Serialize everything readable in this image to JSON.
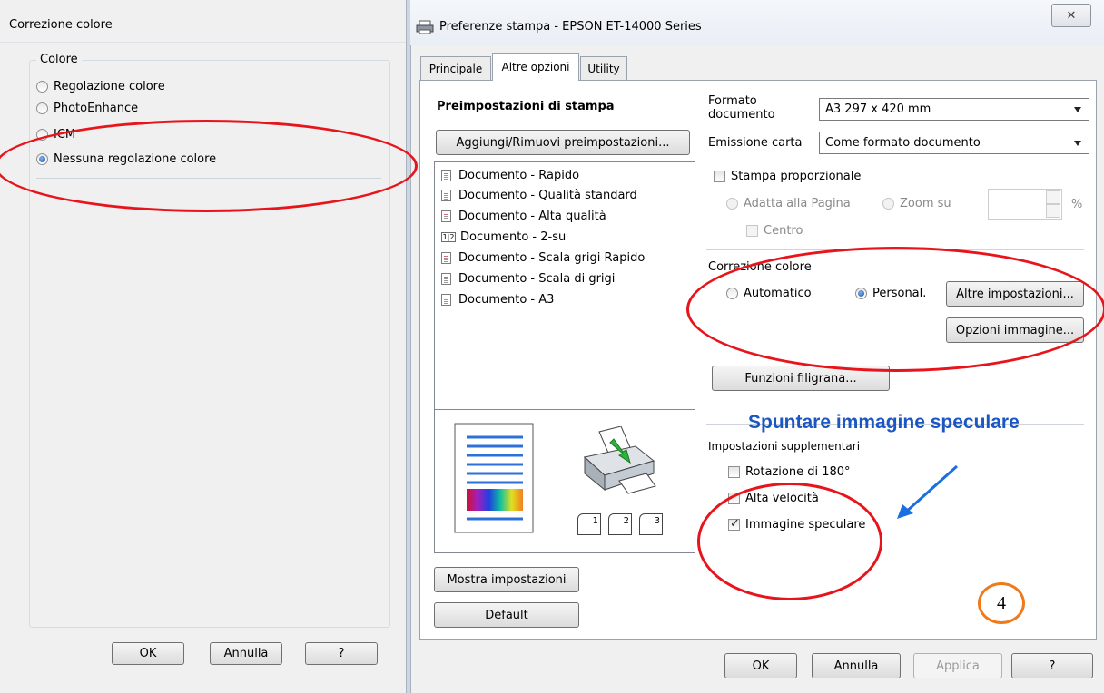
{
  "left_dialog": {
    "title": "Correzione colore",
    "group_label": "Colore",
    "options": [
      {
        "label": "Regolazione colore",
        "selected": false
      },
      {
        "label": "PhotoEnhance",
        "selected": false
      },
      {
        "label": "ICM",
        "selected": false
      },
      {
        "label": "Nessuna regolazione colore",
        "selected": true
      }
    ],
    "buttons": {
      "ok": "OK",
      "cancel": "Annulla",
      "help": "?"
    }
  },
  "right_dialog": {
    "title": "Preferenze stampa - EPSON ET-14000 Series",
    "close": "✕",
    "tabs": [
      {
        "label": "Principale",
        "active": false
      },
      {
        "label": "Altre opzioni",
        "active": true
      },
      {
        "label": "Utility",
        "active": false
      }
    ],
    "presets": {
      "heading": "Preimpostazioni di stampa",
      "manage_button": "Aggiungi/Rimuovi preimpostazioni...",
      "items": [
        {
          "label": "Documento - Rapido",
          "icon": "document-icon"
        },
        {
          "label": "Documento - Qualità standard",
          "icon": "document-icon"
        },
        {
          "label": "Documento - Alta qualità",
          "icon": "document-icon"
        },
        {
          "label": "Documento - 2-su",
          "icon": "two-up-icon",
          "icon_text": "1|2"
        },
        {
          "label": "Documento - Scala grigi Rapido",
          "icon": "document-icon"
        },
        {
          "label": "Documento - Scala di grigi",
          "icon": "document-icon"
        },
        {
          "label": "Documento - A3",
          "icon": "document-icon"
        }
      ],
      "show_settings_button": "Mostra impostazioni",
      "default_button": "Default"
    },
    "preview": {
      "collate_labels": [
        "1",
        "2",
        "3"
      ]
    },
    "paper": {
      "format_label": "Formato documento",
      "format_value": "A3 297 x 420 mm",
      "output_label": "Emissione carta",
      "output_value": "Come formato documento"
    },
    "scaling": {
      "proportional_label": "Stampa proporzionale",
      "fit_page_label": "Adatta alla Pagina",
      "zoom_label": "Zoom su",
      "percent": "%",
      "center_label": "Centro"
    },
    "color_correction": {
      "label": "Correzione colore",
      "auto_label": "Automatico",
      "custom_label": "Personal.",
      "selected": "custom",
      "more_settings_button": "Altre impostazioni...",
      "image_options_button": "Opzioni immagine..."
    },
    "watermark_button": "Funzioni filigrana...",
    "extra": {
      "label": "Impostazioni supplementari",
      "rotate": {
        "label": "Rotazione di 180°",
        "checked": false
      },
      "high_speed": {
        "label": "Alta velocità",
        "checked": false
      },
      "mirror": {
        "label": "Immagine speculare",
        "checked": true
      }
    },
    "footer_buttons": {
      "ok": "OK",
      "cancel": "Annulla",
      "apply": "Applica",
      "help": "?"
    }
  },
  "annotations": {
    "note": "Spuntare immagine speculare",
    "step_number": "4",
    "ellipse_color": "#e8141c",
    "note_color": "#1a56c4",
    "step_color": "#f07a1a"
  }
}
